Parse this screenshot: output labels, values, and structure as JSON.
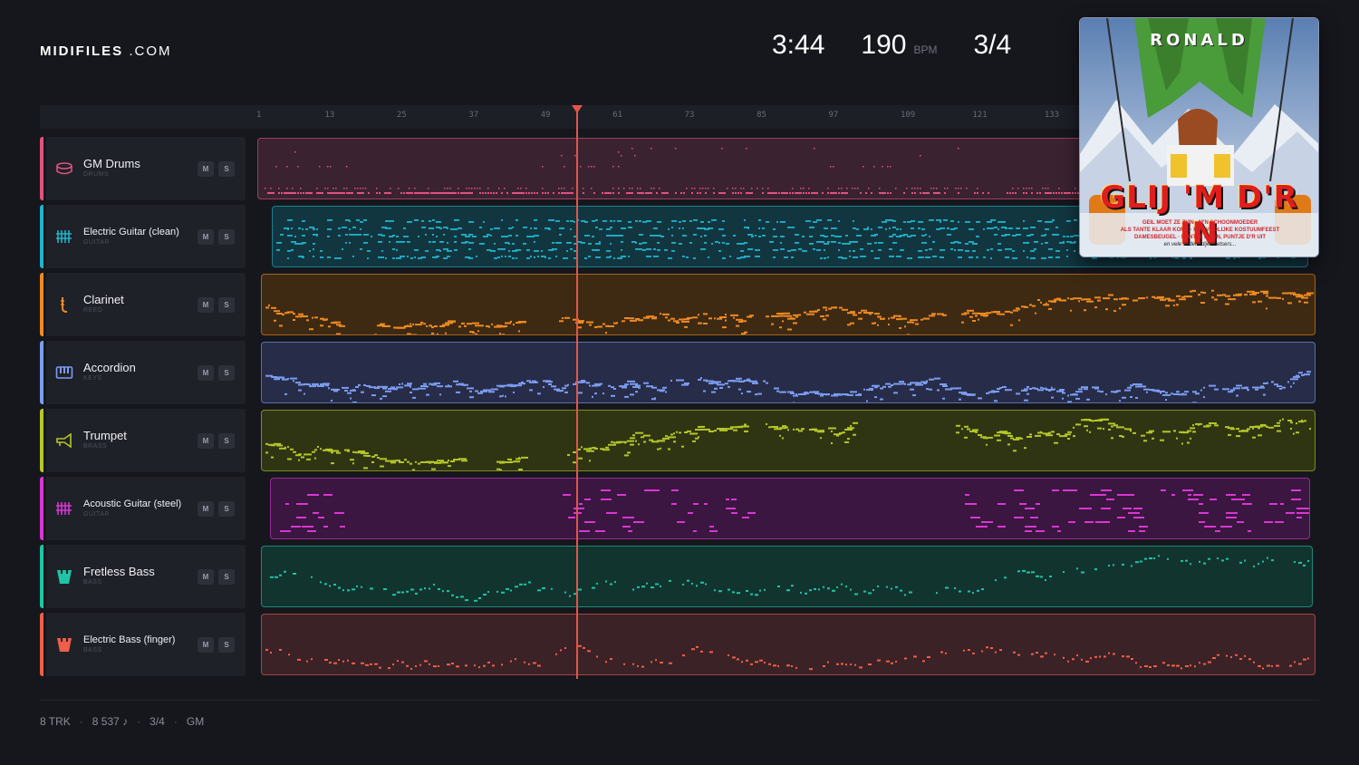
{
  "brand": {
    "name": "MIDIFILES",
    "suffix": ".COM"
  },
  "song_stats": {
    "duration": "3:44",
    "bpm": "190",
    "bpm_unit": "BPM",
    "time_signature": "3/4"
  },
  "ruler": {
    "ticks": [
      "1",
      "13",
      "25",
      "37",
      "49",
      "61",
      "73",
      "85",
      "97",
      "109",
      "121",
      "133"
    ]
  },
  "playhead": {
    "bar": 54
  },
  "tracks": [
    {
      "name": "GM Drums",
      "category": "DRUMS",
      "color": "#e0527e",
      "bg": "#3b2231",
      "icon": "drum-icon",
      "mute": "M",
      "solo": "S"
    },
    {
      "name": "Electric Guitar (clean)",
      "category": "GUITAR",
      "color": "#1fb3cc",
      "bg": "#123640",
      "icon": "guitar-grid-icon",
      "mute": "M",
      "solo": "S"
    },
    {
      "name": "Clarinet",
      "category": "REED",
      "color": "#ee8a22",
      "bg": "#3e2a12",
      "icon": "clarinet-icon",
      "mute": "M",
      "solo": "S"
    },
    {
      "name": "Accordion",
      "category": "KEYS",
      "color": "#7b9cf0",
      "bg": "#272c48",
      "icon": "keyboard-icon",
      "mute": "M",
      "solo": "S"
    },
    {
      "name": "Trumpet",
      "category": "BRASS",
      "color": "#b4c628",
      "bg": "#2f3512",
      "icon": "trumpet-icon",
      "mute": "M",
      "solo": "S"
    },
    {
      "name": "Acoustic Guitar (steel)",
      "category": "GUITAR",
      "color": "#d836d4",
      "bg": "#3b1640",
      "icon": "guitar-grid-icon",
      "mute": "M",
      "solo": "S"
    },
    {
      "name": "Fretless Bass",
      "category": "BASS",
      "color": "#1fc4a6",
      "bg": "#12342f",
      "icon": "bass-icon",
      "mute": "M",
      "solo": "S"
    },
    {
      "name": "Electric Bass (finger)",
      "category": "BASS",
      "color": "#ef5e48",
      "bg": "#3b2226",
      "icon": "bass-icon",
      "mute": "M",
      "solo": "S"
    }
  ],
  "footer": {
    "tracks": "8 TRK",
    "notes": "8 537 ♪",
    "time_signature": "3/4",
    "standard": "GM"
  },
  "album": {
    "artist": "RONALD",
    "title": "GLIJ 'M D'R IN",
    "lines": [
      "GEIL MOET ZE ZIJN · M'N SCHOONMOEDER",
      "ALS TANTE KLAAR KOMT · HET VROLIJKE KOSTUUMFEEST",
      "DAMESBEUGEL · PUNTJE D'R IN, PUNTJE D'R UIT"
    ],
    "last_line": "en vele andere dijenkletsers..."
  }
}
